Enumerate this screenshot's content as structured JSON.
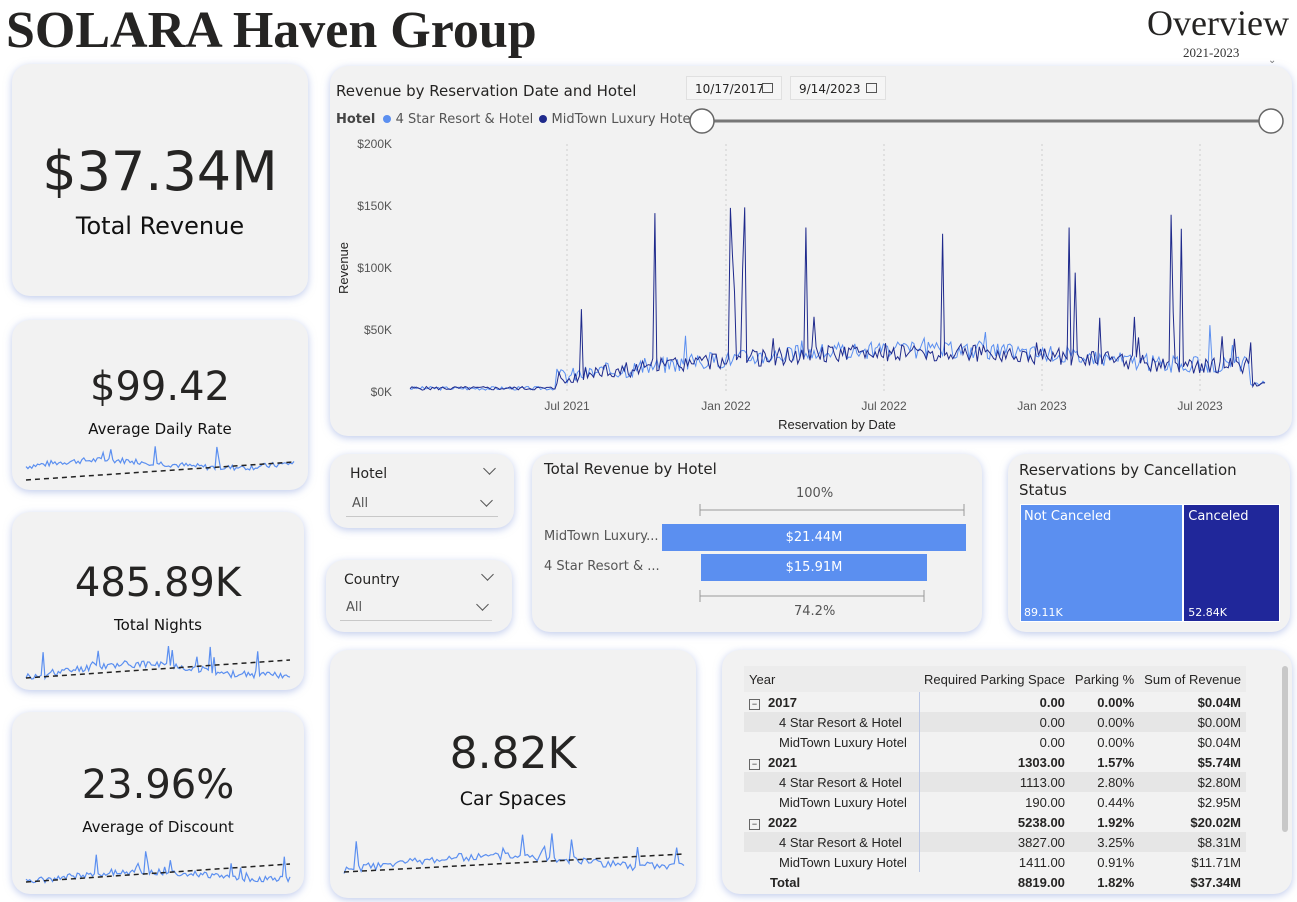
{
  "header": {
    "title": "SOLARA Haven Group",
    "page": "Overview",
    "years": "2021-2023"
  },
  "kpis": {
    "revenue": {
      "value": "$37.34M",
      "label": "Total Revenue"
    },
    "adr": {
      "value": "$99.42",
      "label": "Average Daily Rate"
    },
    "nights": {
      "value": "485.89K",
      "label": "Total Nights"
    },
    "discount": {
      "value": "23.96%",
      "label": "Average of Discount"
    },
    "parking": {
      "value": "8.82K",
      "label": "Car Spaces"
    }
  },
  "line_chart": {
    "title": "Revenue by Reservation Date and Hotel",
    "legend_title": "Hotel",
    "series": [
      {
        "name": "4 Star Resort & Hotel",
        "color": "#5b8ff0"
      },
      {
        "name": "MidTown Luxury Hotel",
        "color": "#1f2a8c"
      }
    ],
    "date_from": "10/17/2017",
    "date_to": "9/14/2023",
    "y_ticks": [
      "$200K",
      "$150K",
      "$100K",
      "$50K",
      "$0K"
    ],
    "x_ticks": [
      "Jul 2021",
      "Jan 2022",
      "Jul 2022",
      "Jan 2023",
      "Jul 2023"
    ],
    "ylabel": "Revenue",
    "xlabel": "Reservation by Date"
  },
  "slicers": {
    "hotel": {
      "title": "Hotel",
      "value": "All"
    },
    "country": {
      "title": "Country",
      "value": "All"
    }
  },
  "funnel": {
    "title": "Total Revenue by Hotel",
    "top_pct": "100%",
    "bottom_pct": "74.2%",
    "rows": [
      {
        "label": "MidTown Luxury...",
        "value": "$21.44M",
        "fraction": 1.0
      },
      {
        "label": "4 Star Resort & ...",
        "value": "$15.91M",
        "fraction": 0.742
      }
    ]
  },
  "treemap": {
    "title": "Reservations by Cancellation Status",
    "cells": [
      {
        "label": "Not Canceled",
        "value": "89.11K",
        "fraction": 0.628,
        "color": "#5b8ff0"
      },
      {
        "label": "Canceled",
        "value": "52.84K",
        "fraction": 0.372,
        "color": "#20279a"
      }
    ]
  },
  "matrix": {
    "headers": [
      "Year",
      "Required Parking Space",
      "Parking %",
      "Sum of Revenue"
    ],
    "rows": [
      {
        "type": "group",
        "label": "2017",
        "parking": "0.00",
        "pct": "0.00%",
        "revenue": "$0.04M"
      },
      {
        "type": "child",
        "label": "4 Star Resort & Hotel",
        "parking": "0.00",
        "pct": "0.00%",
        "revenue": "$0.00M"
      },
      {
        "type": "child",
        "label": "MidTown Luxury Hotel",
        "parking": "0.00",
        "pct": "0.00%",
        "revenue": "$0.04M"
      },
      {
        "type": "group",
        "label": "2021",
        "parking": "1303.00",
        "pct": "1.57%",
        "revenue": "$5.74M"
      },
      {
        "type": "child",
        "label": "4 Star Resort & Hotel",
        "parking": "1113.00",
        "pct": "2.80%",
        "revenue": "$2.80M"
      },
      {
        "type": "child",
        "label": "MidTown Luxury Hotel",
        "parking": "190.00",
        "pct": "0.44%",
        "revenue": "$2.95M"
      },
      {
        "type": "group",
        "label": "2022",
        "parking": "5238.00",
        "pct": "1.92%",
        "revenue": "$20.02M"
      },
      {
        "type": "child",
        "label": "4 Star Resort & Hotel",
        "parking": "3827.00",
        "pct": "3.25%",
        "revenue": "$8.31M"
      },
      {
        "type": "child",
        "label": "MidTown Luxury Hotel",
        "parking": "1411.00",
        "pct": "0.91%",
        "revenue": "$11.71M"
      }
    ],
    "total": {
      "label": "Total",
      "parking": "8819.00",
      "pct": "1.82%",
      "revenue": "$37.34M"
    }
  }
}
